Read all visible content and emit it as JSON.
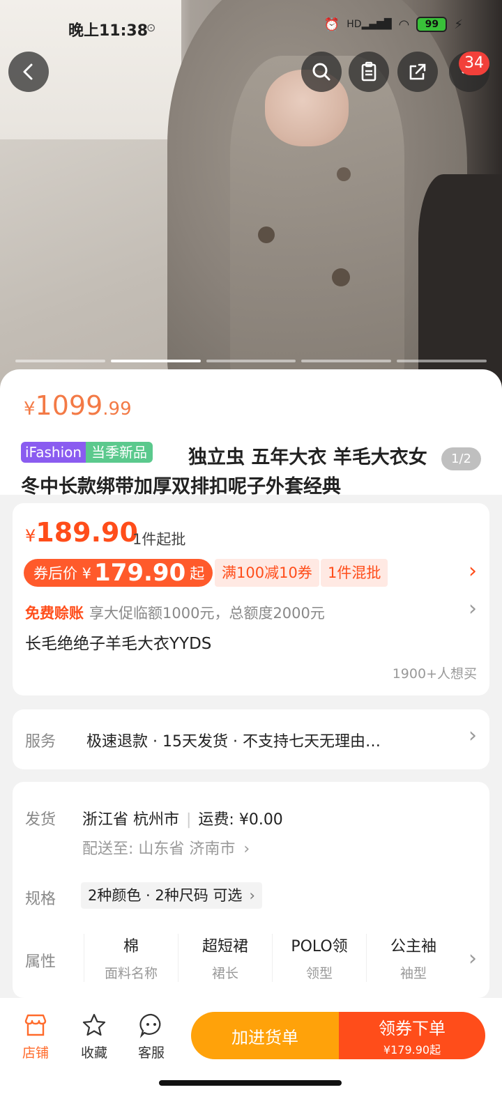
{
  "status_bar": {
    "time": "晚上11:38",
    "network": "HD",
    "battery": "99"
  },
  "top_actions": {
    "cart_badge": "34"
  },
  "product": {
    "original_price": {
      "yen": "¥",
      "int": "1099",
      "dec": ".99"
    },
    "tags": {
      "brand": "iFashion",
      "season": "当季新品"
    },
    "title_line1": "独立虫 五年大衣 羊毛大衣女",
    "title_line2": "冬中长款绑带加厚双排扣呢子外套经典",
    "image_index": "1/2"
  },
  "price_card": {
    "yen": "¥",
    "price": "189.90",
    "min_order": "1件起批",
    "coupon": {
      "prefix": "券后价 ¥",
      "amount": "179.90",
      "suffix": "起"
    },
    "promo1": "满100减10券",
    "promo2": "1件混批",
    "credit_label": "免费赊账",
    "credit_text": "享大促临额1000元，总额度2000元",
    "subtitle": "长毛绝绝子羊毛大衣YYDS",
    "want_count": "1900+人想买"
  },
  "service": {
    "label": "服务",
    "text": "极速退款 · 15天发货 · 不支持七天无理由…"
  },
  "shipping": {
    "label": "发货",
    "from": "浙江省 杭州市",
    "fee": "运费: ¥0.00",
    "to": "配送至: 山东省 济南市"
  },
  "spec": {
    "label": "规格",
    "value": "2种颜色 · 2种尺码 可选"
  },
  "attributes": {
    "label": "属性",
    "items": [
      {
        "value": "棉",
        "key": "面料名称"
      },
      {
        "value": "超短裙",
        "key": "裙长"
      },
      {
        "value": "POLO领",
        "key": "领型"
      },
      {
        "value": "公主袖",
        "key": "袖型"
      }
    ]
  },
  "bottom_bar": {
    "store": "店铺",
    "favorite": "收藏",
    "service": "客服",
    "add_to_list": "加进货单",
    "buy": "领券下单",
    "buy_price": "¥179.90起"
  },
  "colors": {
    "accent": "#ff4d1a",
    "orange": "#ffa20a",
    "soft_price": "#f37a46"
  }
}
